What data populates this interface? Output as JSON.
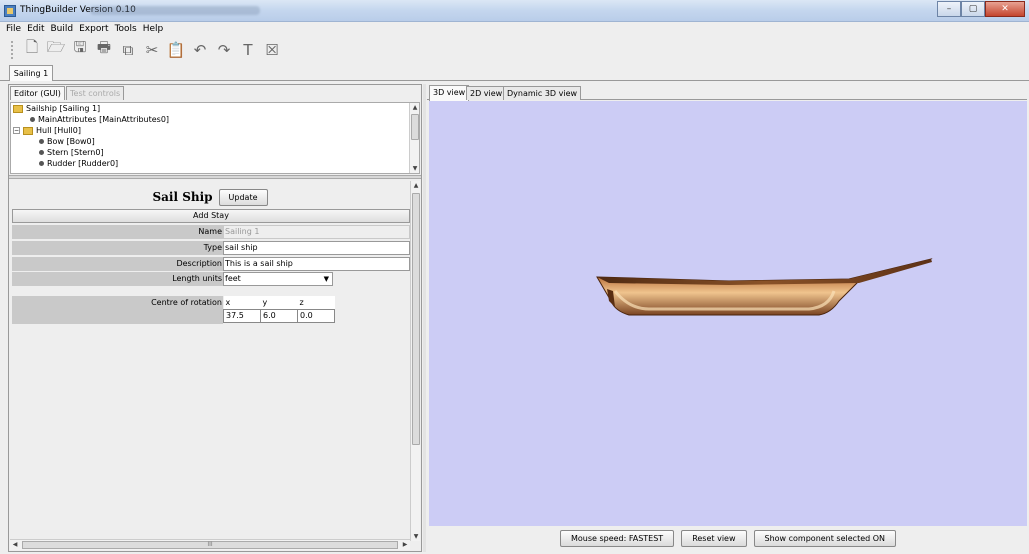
{
  "window": {
    "title": "ThingBuilder Version 0.10",
    "controls": {
      "minimize": "–",
      "maximize": "▢",
      "close": "✕"
    }
  },
  "menu": [
    "File",
    "Edit",
    "Build",
    "Export",
    "Tools",
    "Help"
  ],
  "toolbar": {
    "icons": [
      "new-document-icon",
      "open-folder-icon",
      "save-icon",
      "print-icon",
      "copy-icon",
      "cut-icon",
      "paste-icon",
      "undo-icon",
      "redo-icon",
      "build-icon",
      "close-document-icon"
    ],
    "glyphs": [
      "🗋",
      "🗁",
      "🖫",
      "🖶",
      "⧉",
      "✂",
      "📋",
      "↶",
      "↷",
      "T",
      "☒"
    ]
  },
  "document_tab": "Sailing 1",
  "left_tabs": {
    "editor": "Editor (GUI)",
    "test": "Test controls"
  },
  "tree": {
    "items": [
      {
        "label": "Sailship [Sailing 1]",
        "type": "folder"
      },
      {
        "label": "MainAttributes [MainAttributes0]",
        "type": "leaf"
      },
      {
        "label": "Hull [Hull0]",
        "type": "folder"
      },
      {
        "label": "Bow [Bow0]",
        "type": "leaf"
      },
      {
        "label": "Stern [Stern0]",
        "type": "leaf"
      },
      {
        "label": "Rudder [Rudder0]",
        "type": "leaf"
      }
    ]
  },
  "editor": {
    "title": "Sail Ship",
    "update_label": "Update",
    "add_stay_label": "Add Stay",
    "properties": {
      "name_label": "Name",
      "name_value": "Sailing 1",
      "type_label": "Type",
      "type_value": "sail ship",
      "description_label": "Description",
      "description_value": "This is a sail ship",
      "length_units_label": "Length units",
      "length_units_value": "feet"
    },
    "centre_of_rotation": {
      "label": "Centre of rotation",
      "headers": [
        "x",
        "y",
        "z"
      ],
      "values": [
        "37.5",
        "6.0",
        "0.0"
      ]
    },
    "hscroll_grip": "III"
  },
  "view_tabs": {
    "tab_3d": "3D view",
    "tab_2d": "2D view",
    "tab_dynamic": "Dynamic 3D view"
  },
  "colors": {
    "viewport_bg": "#ccccf5",
    "hull_dark": "#6b3818",
    "hull_light": "#f0c48e"
  },
  "bottom_buttons": {
    "mouse_speed": "Mouse speed: FASTEST",
    "reset_view": "Reset view",
    "show_component": "Show component selected  ON"
  }
}
